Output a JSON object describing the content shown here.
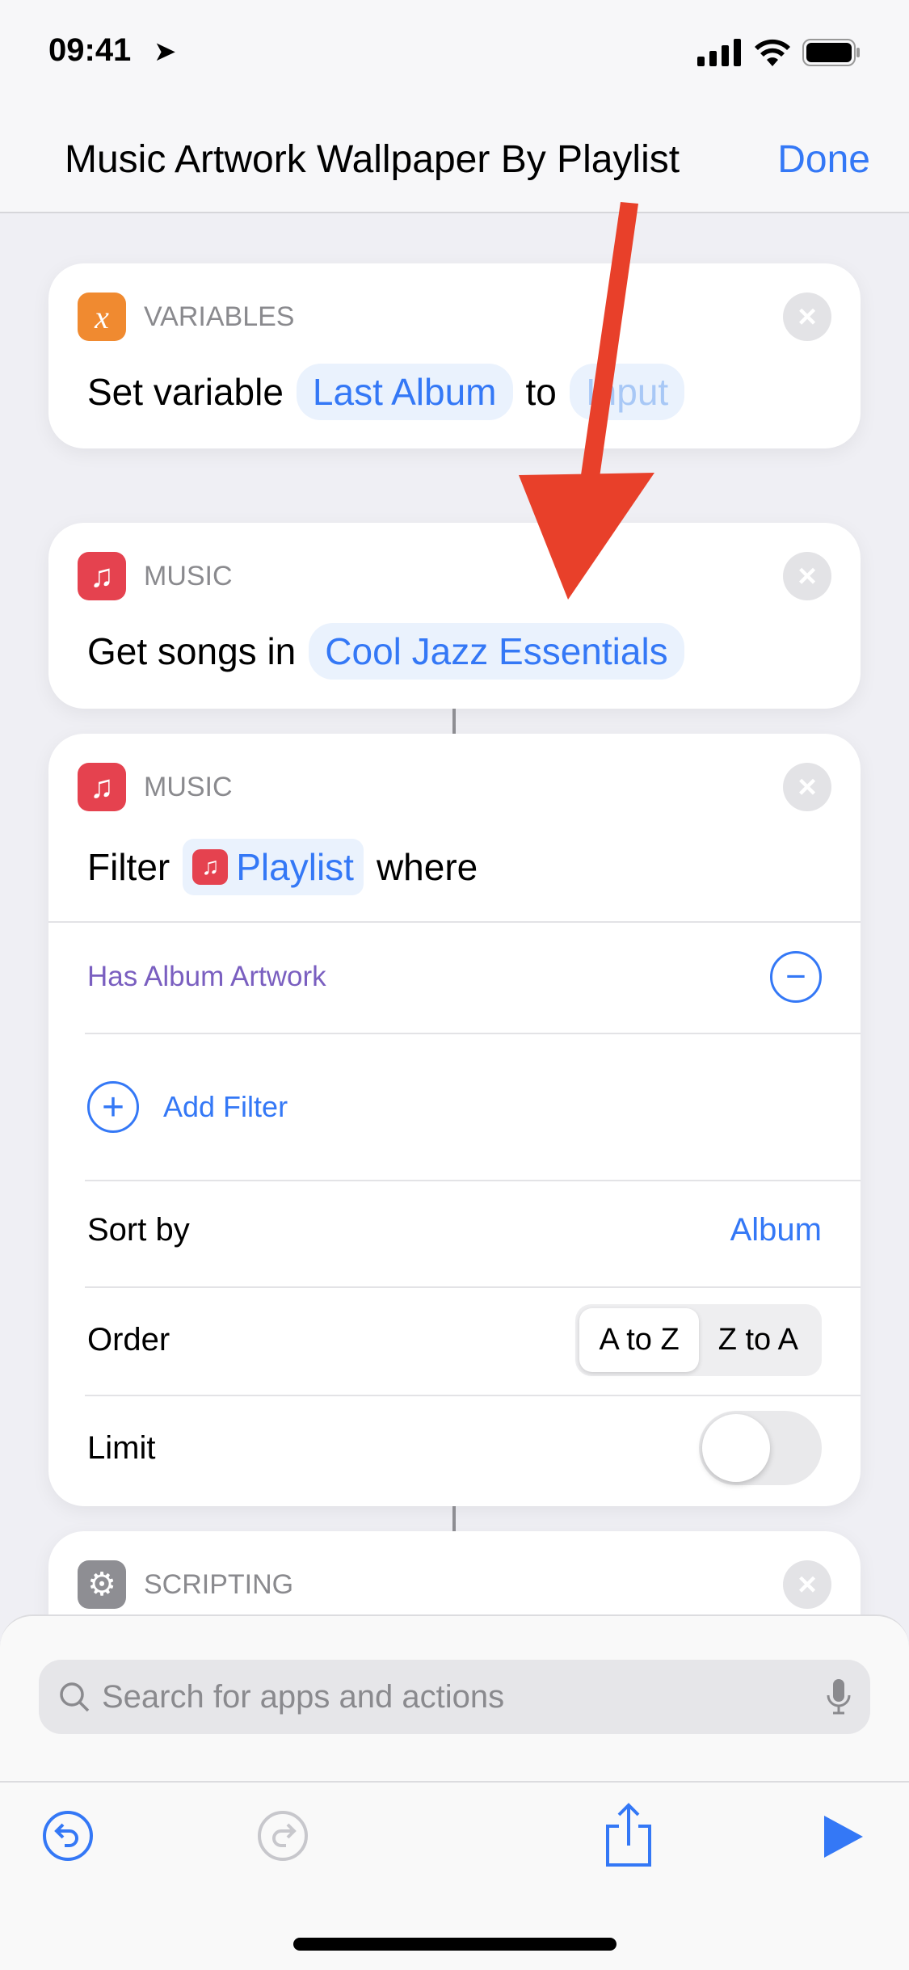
{
  "status": {
    "time": "09:41"
  },
  "header": {
    "title": "Music Artwork Wallpaper By Playlist",
    "done": "Done"
  },
  "actions": [
    {
      "category": "VARIABLES",
      "text1": "Set variable",
      "var": "Last Album",
      "text2": "to",
      "value": "Input"
    },
    {
      "category": "MUSIC",
      "text1": "Get songs in",
      "playlist": "Cool Jazz Essentials"
    },
    {
      "category": "MUSIC",
      "text1": "Filter",
      "token": "Playlist",
      "text2": "where",
      "filter": "Has Album Artwork",
      "add_filter": "Add Filter",
      "sort_label": "Sort by",
      "sort_value": "Album",
      "order_label": "Order",
      "order_options": [
        "A to Z",
        "Z to A"
      ],
      "order_selected": "A to Z",
      "limit_label": "Limit",
      "limit_on": false
    },
    {
      "category": "SCRIPTING"
    }
  ],
  "search": {
    "placeholder": "Search for apps and actions"
  },
  "colors": {
    "accent": "#3478f6",
    "annotation_arrow": "#e8402a",
    "variables": "#f08a30",
    "music": "#e5424f",
    "scripting": "#8e8e93"
  }
}
